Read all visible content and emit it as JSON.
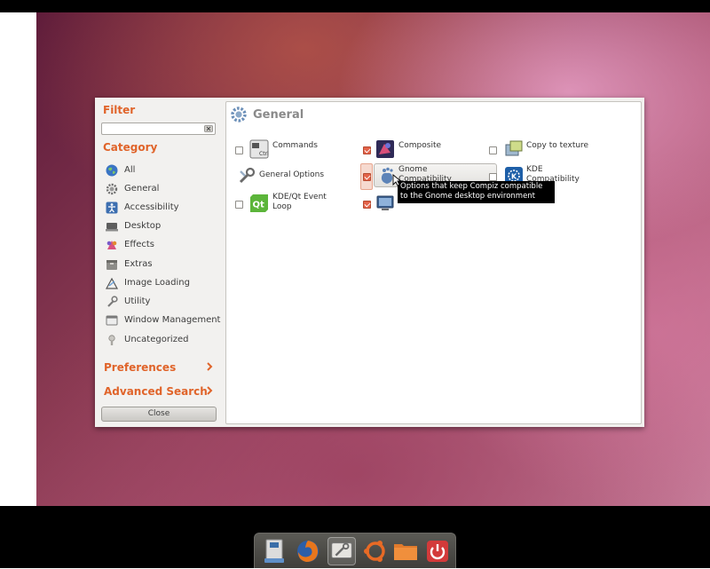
{
  "window": {
    "filter_heading": "Filter",
    "category_heading": "Category",
    "search": {
      "value": "",
      "placeholder": ""
    },
    "categories": [
      {
        "label": "All",
        "icon": "globe-icon"
      },
      {
        "label": "General",
        "icon": "gear-icon"
      },
      {
        "label": "Accessibility",
        "icon": "accessibility-icon"
      },
      {
        "label": "Desktop",
        "icon": "desktop-icon"
      },
      {
        "label": "Effects",
        "icon": "effects-icon"
      },
      {
        "label": "Extras",
        "icon": "extras-icon"
      },
      {
        "label": "Image Loading",
        "icon": "image-icon"
      },
      {
        "label": "Utility",
        "icon": "utility-icon"
      },
      {
        "label": "Window Management",
        "icon": "window-icon"
      },
      {
        "label": "Uncategorized",
        "icon": "uncategorized-icon"
      }
    ],
    "preferences_label": "Preferences",
    "advanced_search_label": "Advanced Search",
    "close_label": "Close",
    "content_title": "General",
    "plugins": [
      {
        "label": "Commands",
        "checked": false,
        "icon": "commands-icon"
      },
      {
        "label": "Composite",
        "checked": true,
        "icon": "composite-icon"
      },
      {
        "label": "Copy to texture",
        "checked": false,
        "icon": "copy-texture-icon"
      },
      {
        "label": "General Options",
        "checked": null,
        "icon": "general-options-icon"
      },
      {
        "label": "Gnome\nCompatibility",
        "checked": true,
        "icon": "gnome-icon"
      },
      {
        "label": "KDE\nCompatibility",
        "checked": false,
        "icon": "kde-icon"
      },
      {
        "label": "KDE/Qt Event\nLoop",
        "checked": false,
        "icon": "qt-icon"
      },
      {
        "label": "",
        "checked": true,
        "icon": "display-icon"
      }
    ],
    "tooltip": "Options that keep Compiz compatible to the Gnome desktop environment"
  },
  "dock": {
    "items": [
      "files-icon",
      "firefox-icon",
      "settings-icon",
      "ubuntu-icon",
      "folder-icon",
      "power-icon"
    ],
    "active_item": "settings-icon"
  },
  "colors": {
    "accent": "#e0642a",
    "checked": "#e3634a"
  }
}
